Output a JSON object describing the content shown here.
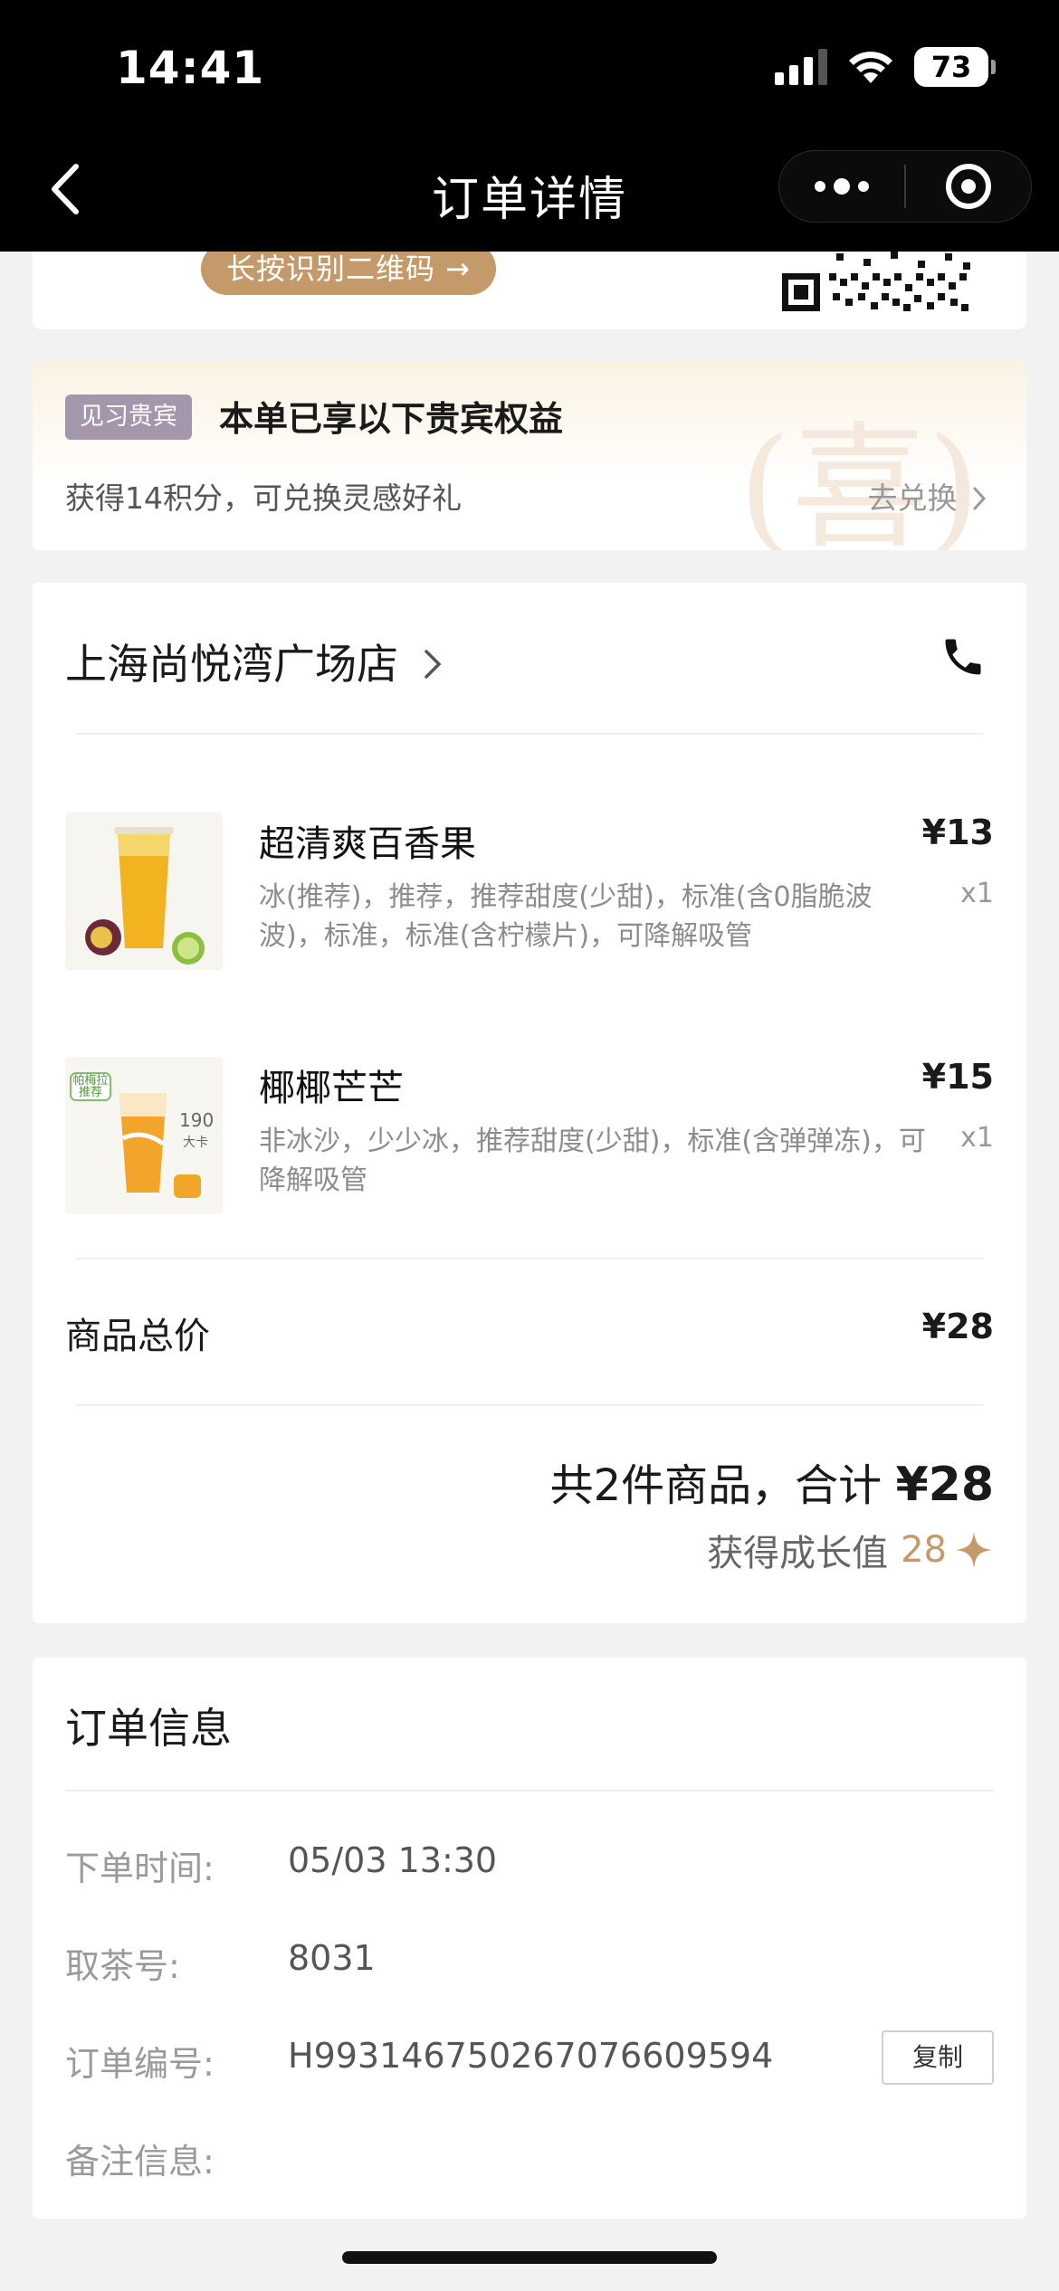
{
  "status_bar": {
    "time": "14:41",
    "battery": "73"
  },
  "nav": {
    "title": "订单详情"
  },
  "qr": {
    "pill_label": "长按识别二维码 →"
  },
  "vip": {
    "badge": "见习贵宾",
    "title": "本单已享以下贵宾权益",
    "subtitle": "获得14积分，可兑换灵感好礼",
    "link": "去兑换",
    "deco": "(喜)"
  },
  "store": {
    "name": "上海尚悦湾广场店"
  },
  "items": [
    {
      "name": "超清爽百香果",
      "desc": "冰(推荐)，推荐，推荐甜度(少甜)，标准(含0脂脆波波)，标准，标准(含柠檬片)，可降解吸管",
      "price": "¥13",
      "qty": "x1"
    },
    {
      "name": "椰椰芒芒",
      "desc": "非冰沙，少少冰，推荐甜度(少甜)，标准(含弹弹冻)，可降解吸管",
      "price": "¥15",
      "qty": "x1",
      "img_tag": "帕梅拉推荐",
      "img_badge": "190",
      "img_badge_sub": "大卡"
    }
  ],
  "summary": {
    "subtotal_label": "商品总价",
    "subtotal_value": "¥28",
    "total_prefix": "共2件商品，合计",
    "total_value": "¥28",
    "growth_label": "获得成长值",
    "growth_value": "28"
  },
  "order_info": {
    "title": "订单信息",
    "rows": [
      {
        "label": "下单时间:",
        "value": "05/03 13:30"
      },
      {
        "label": "取茶号:",
        "value": "8031"
      },
      {
        "label": "订单编号:",
        "value": "H993146750267076609594"
      },
      {
        "label": "备注信息:",
        "value": ""
      }
    ],
    "copy_label": "复制"
  },
  "icons": [
    "chevron-left-icon",
    "more-dots-icon",
    "target-icon",
    "phone-icon",
    "chevron-right-icon",
    "sparkle-icon",
    "qr-code-icon",
    "wifi-icon",
    "signal-icon",
    "battery-icon"
  ],
  "colors": {
    "accent_gold": "#c59a6a",
    "badge_purple": "#a597ab",
    "nav_bg": "#000000"
  }
}
